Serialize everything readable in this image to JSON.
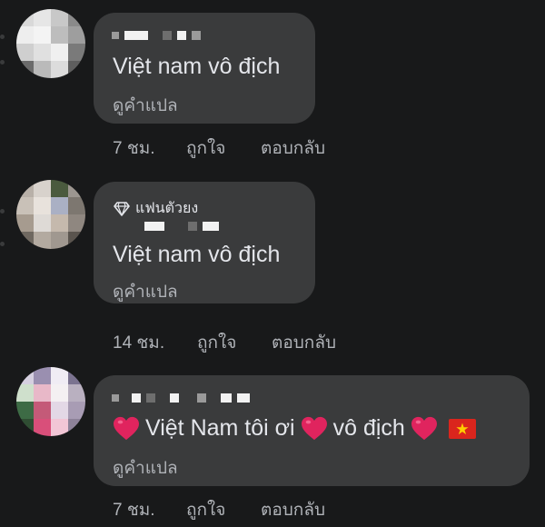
{
  "comments": [
    {
      "text": "Việt nam vô địch",
      "translate_label": "ดูคำแปล",
      "time": "7 ชม.",
      "like_label": "ถูกใจ",
      "reply_label": "ตอบกลับ"
    },
    {
      "badge_icon": "diamond-icon",
      "badge_label": "แฟนตัวยง",
      "text": "Việt nam vô địch",
      "translate_label": "ดูคำแปล",
      "time": "14 ชม.",
      "like_label": "ถูกใจ",
      "reply_label": "ตอบกลับ"
    },
    {
      "text_parts": [
        "Việt Nam tôi ơi",
        "vô địch"
      ],
      "icons": [
        "red-heart-icon",
        "red-heart-icon",
        "red-heart-icon",
        "vietnam-flag-icon"
      ],
      "translate_label": "ดูคำแปล",
      "time": "7 ชม.",
      "like_label": "ถูกใจ",
      "reply_label": "ตอบกลับ"
    }
  ],
  "colors": {
    "background": "#18191a",
    "bubble": "#3a3b3c",
    "primary_text": "#e4e6eb",
    "secondary_text": "#b0b3b8",
    "heart": "#e0245e",
    "flag_red": "#da251d",
    "flag_star": "#ffcd00"
  }
}
